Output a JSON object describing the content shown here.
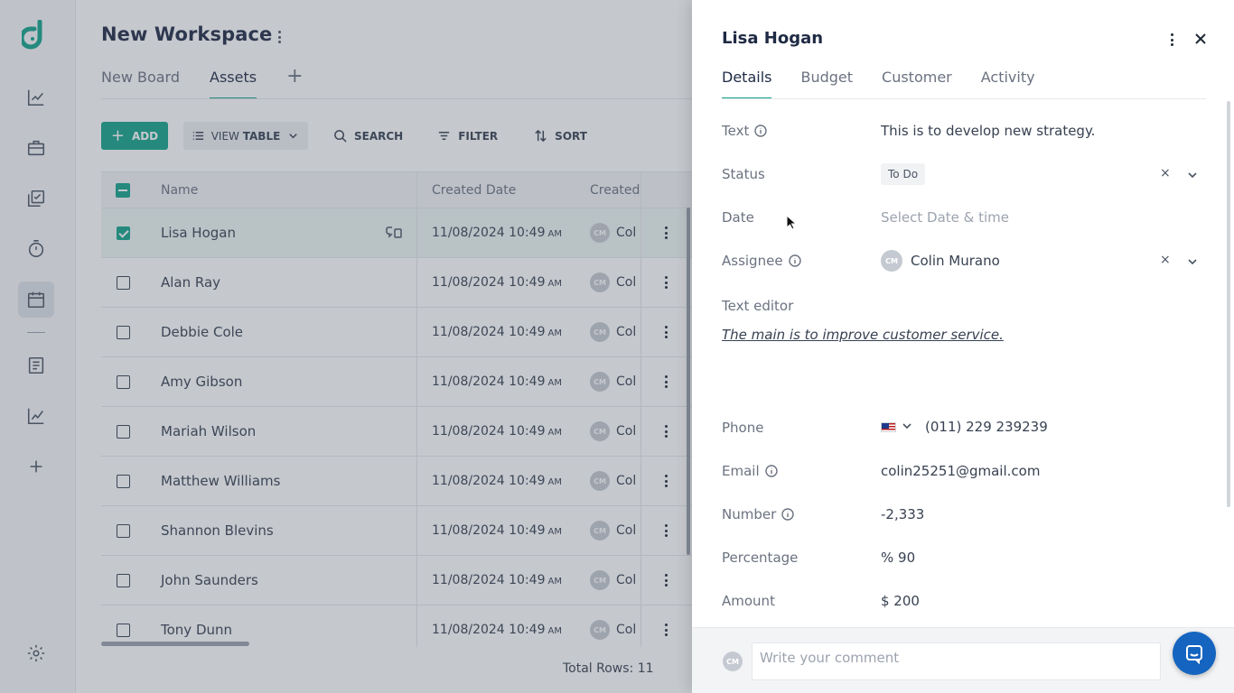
{
  "workspace": {
    "title": "New Workspace",
    "tabs": [
      {
        "label": "New Board",
        "active": false
      },
      {
        "label": "Assets",
        "active": true
      }
    ],
    "add_tab_label": "+"
  },
  "toolbar": {
    "add_label": "ADD",
    "view_label_prefix": "VIEW",
    "view_label_strong": "TABLE",
    "search_label": "SEARCH",
    "filter_label": "FILTER",
    "sort_label": "SORT"
  },
  "table": {
    "columns": [
      "Name",
      "Created Date",
      "Created"
    ],
    "rows": [
      {
        "name": "Lisa Hogan",
        "date": "11/08/2024 10:49",
        "ampm": "AM",
        "user_initials": "CM",
        "user_short": "Col",
        "checked": true
      },
      {
        "name": "Alan Ray",
        "date": "11/08/2024 10:49",
        "ampm": "AM",
        "user_initials": "CM",
        "user_short": "Col",
        "checked": false
      },
      {
        "name": "Debbie Cole",
        "date": "11/08/2024 10:49",
        "ampm": "AM",
        "user_initials": "CM",
        "user_short": "Col",
        "checked": false
      },
      {
        "name": "Amy Gibson",
        "date": "11/08/2024 10:49",
        "ampm": "AM",
        "user_initials": "CM",
        "user_short": "Col",
        "checked": false
      },
      {
        "name": "Mariah Wilson",
        "date": "11/08/2024 10:49",
        "ampm": "AM",
        "user_initials": "CM",
        "user_short": "Col",
        "checked": false
      },
      {
        "name": "Matthew Williams",
        "date": "11/08/2024 10:49",
        "ampm": "AM",
        "user_initials": "CM",
        "user_short": "Col",
        "checked": false
      },
      {
        "name": "Shannon Blevins",
        "date": "11/08/2024 10:49",
        "ampm": "AM",
        "user_initials": "CM",
        "user_short": "Col",
        "checked": false
      },
      {
        "name": "John Saunders",
        "date": "11/08/2024 10:49",
        "ampm": "AM",
        "user_initials": "CM",
        "user_short": "Col",
        "checked": false
      },
      {
        "name": "Tony Dunn",
        "date": "11/08/2024 10:49",
        "ampm": "AM",
        "user_initials": "CM",
        "user_short": "Col",
        "checked": false
      }
    ],
    "total_rows": "Total Rows: 11"
  },
  "panel": {
    "title": "Lisa Hogan",
    "tabs": [
      {
        "label": "Details",
        "active": true
      },
      {
        "label": "Budget",
        "active": false
      },
      {
        "label": "Customer",
        "active": false
      },
      {
        "label": "Activity",
        "active": false
      }
    ],
    "fields": {
      "text_label": "Text",
      "text_value": "This is to develop new strategy.",
      "status_label": "Status",
      "status_value": "To Do",
      "date_label": "Date",
      "date_placeholder": "Select Date & time",
      "assignee_label": "Assignee",
      "assignee_initials": "CM",
      "assignee_name": "Colin Murano",
      "text_editor_label": "Text editor",
      "text_editor_value": "The main is to improve customer service.",
      "phone_label": "Phone",
      "phone_value": "(011) 229 239239",
      "email_label": "Email",
      "email_value": "colin25251@gmail.com",
      "number_label": "Number",
      "number_value": "-2,333",
      "percentage_label": "Percentage",
      "percentage_value": "% 90",
      "amount_label": "Amount",
      "amount_value": "$ 200"
    },
    "clear_symbol": "×"
  },
  "comment": {
    "avatar_initials": "CM",
    "placeholder": "Write your comment"
  },
  "colors": {
    "accent": "#14a38b",
    "chat_button": "#1565c0"
  },
  "icons": [
    "logo-icon",
    "analytics-icon",
    "briefcase-icon",
    "checklist-icon",
    "timer-icon",
    "calendar-icon",
    "document-icon",
    "trend-icon",
    "plus-icon",
    "gear-icon",
    "search-icon",
    "filter-icon",
    "sort-icon",
    "list-icon",
    "chevron-down-icon",
    "close-icon",
    "info-icon",
    "chat-icon",
    "flag-us-icon"
  ]
}
